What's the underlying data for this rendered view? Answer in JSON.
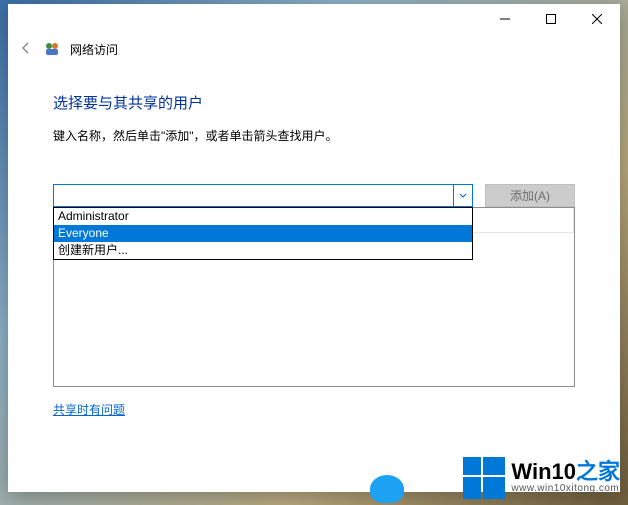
{
  "titlebar": {
    "minimize": "—",
    "maximize": "▢",
    "close": "✕"
  },
  "header": {
    "back": "←",
    "title": "网络访问"
  },
  "content": {
    "heading": "选择要与其共享的用户",
    "instruction": "键入名称，然后单击\"添加\"，或者单击箭头查找用户。",
    "combo_value": "",
    "add_button": "添加(A)",
    "dropdown": {
      "items": [
        "Administrator",
        "Everyone",
        "创建新用户..."
      ],
      "selected_index": 1
    },
    "trouble_link": "共享时有问题"
  },
  "watermark": {
    "brand_prefix": "Win10",
    "brand_suffix": "之家",
    "url": "www.win10xitong.com"
  }
}
